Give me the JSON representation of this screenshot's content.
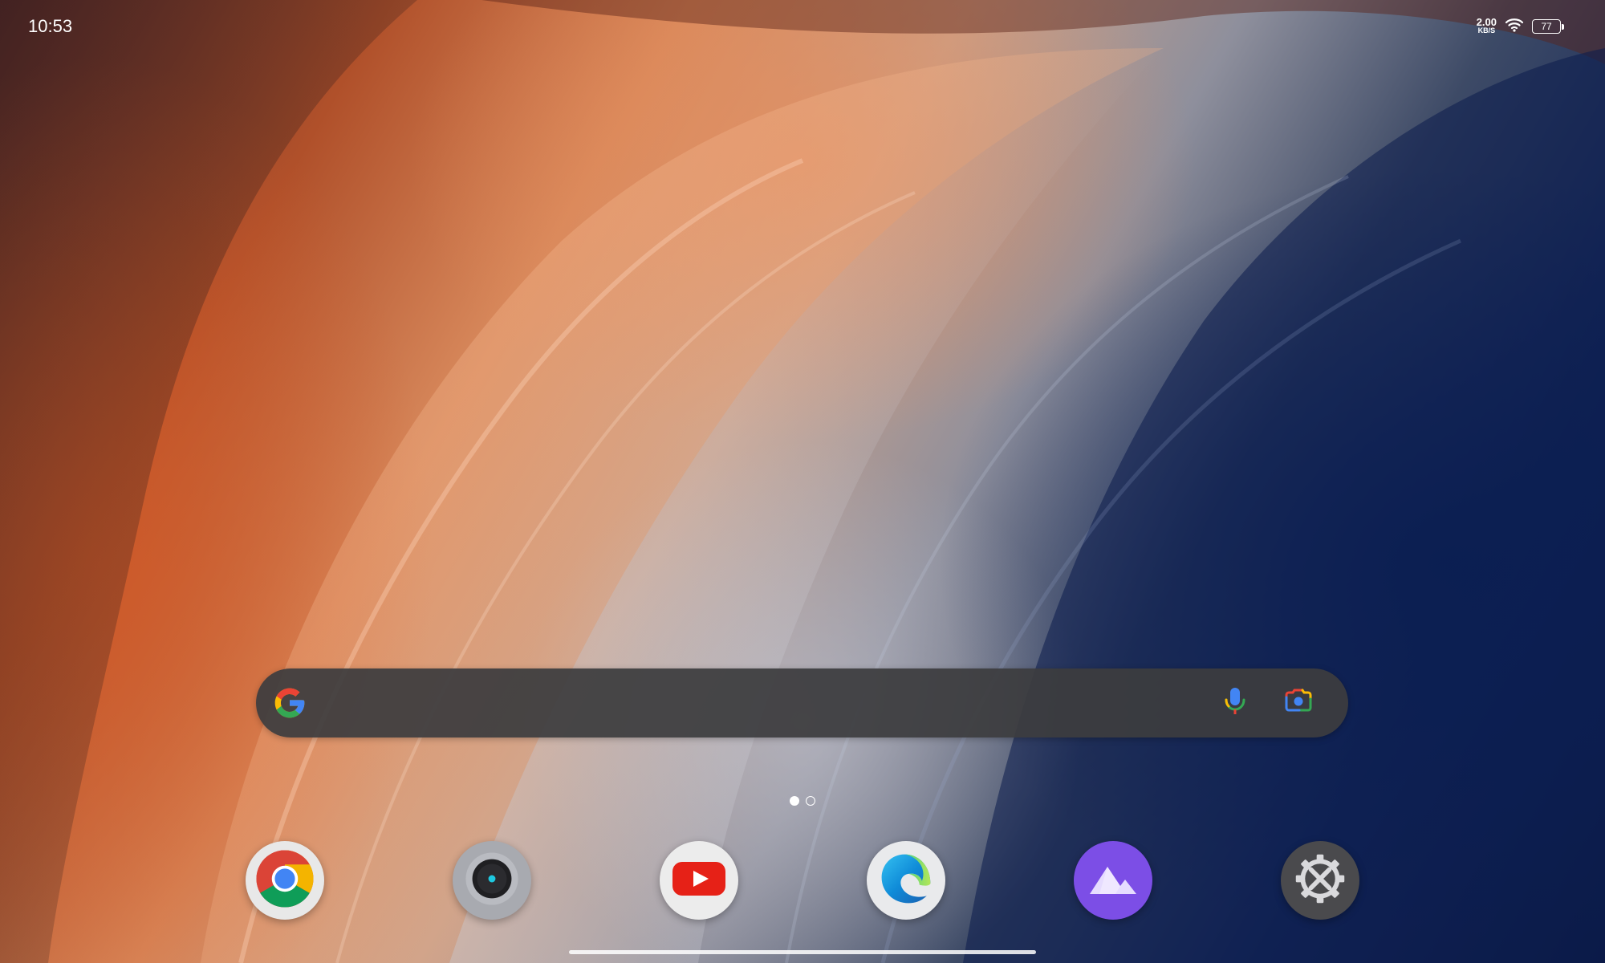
{
  "status_bar": {
    "time": "10:53",
    "net_speed_value": "2.00",
    "net_speed_unit": "KB/S",
    "wifi_icon": "wifi-icon",
    "battery_level": "77"
  },
  "search_widget": {
    "logo_icon": "google-g-icon",
    "mic_icon": "microphone-icon",
    "lens_icon": "google-lens-icon",
    "colors": {
      "background": "#3c3c3e",
      "blue": "#4285F4",
      "red": "#EA4335",
      "yellow": "#FBBC05",
      "green": "#34A853"
    }
  },
  "page_indicator": {
    "pages": 2,
    "current": 1
  },
  "dock": {
    "apps": [
      {
        "icon": "chrome-icon"
      },
      {
        "icon": "camera-icon"
      },
      {
        "icon": "youtube-icon"
      },
      {
        "icon": "edge-icon"
      },
      {
        "icon": "gallery-icon"
      },
      {
        "icon": "settings-icon"
      }
    ]
  },
  "navigation": {
    "gesture_handle": "home-gesture-handle"
  }
}
